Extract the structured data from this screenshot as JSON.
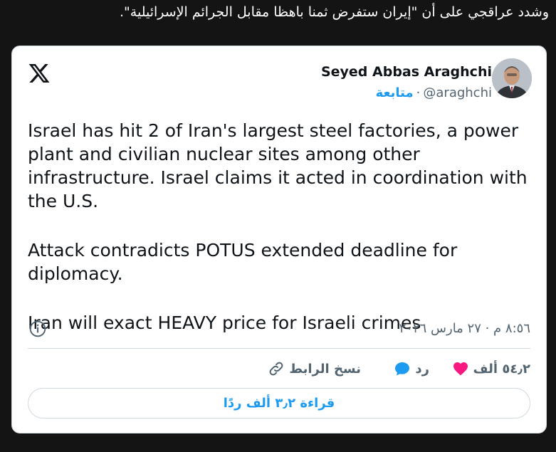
{
  "article": {
    "line": "وشدد عراقجي على أن \"إيران ستفرض ثمنا باهظا مقابل الجرائم الإسرائيلية\"."
  },
  "tweet": {
    "author_name": "Seyed Abbas Araghchi",
    "handle": "@araghchi",
    "follow_label": "متابعة",
    "separator": "·",
    "paragraphs": [
      "Israel has hit 2 of Iran's largest steel factories, a power plant and civilian nuclear sites among other infrastructure. Israel claims it acted in coordination with the U.S.",
      "Attack contradicts POTUS extended deadline for diplomacy.",
      "Iran will exact HEAVY price for Israeli crimes"
    ],
    "timestamp": "٨:٥٦ م · ٢٧ مارس ٢٠٢٦",
    "likes_count": "٥٤٫٢ ألف",
    "reply_label": "رد",
    "copy_link_label": "نسخ الرابط",
    "read_replies_label": "قراءة ٣٫٢ ألف ردًا"
  },
  "icons": {
    "logo": "x-logo-icon",
    "info": "info-icon",
    "like": "heart-icon",
    "reply": "speech-bubble-icon",
    "copy": "link-icon"
  },
  "colors": {
    "accent": "#1d9bf0",
    "like": "#f91880",
    "text": "#0f1419",
    "muted": "#536471",
    "page_bg": "#141414"
  }
}
